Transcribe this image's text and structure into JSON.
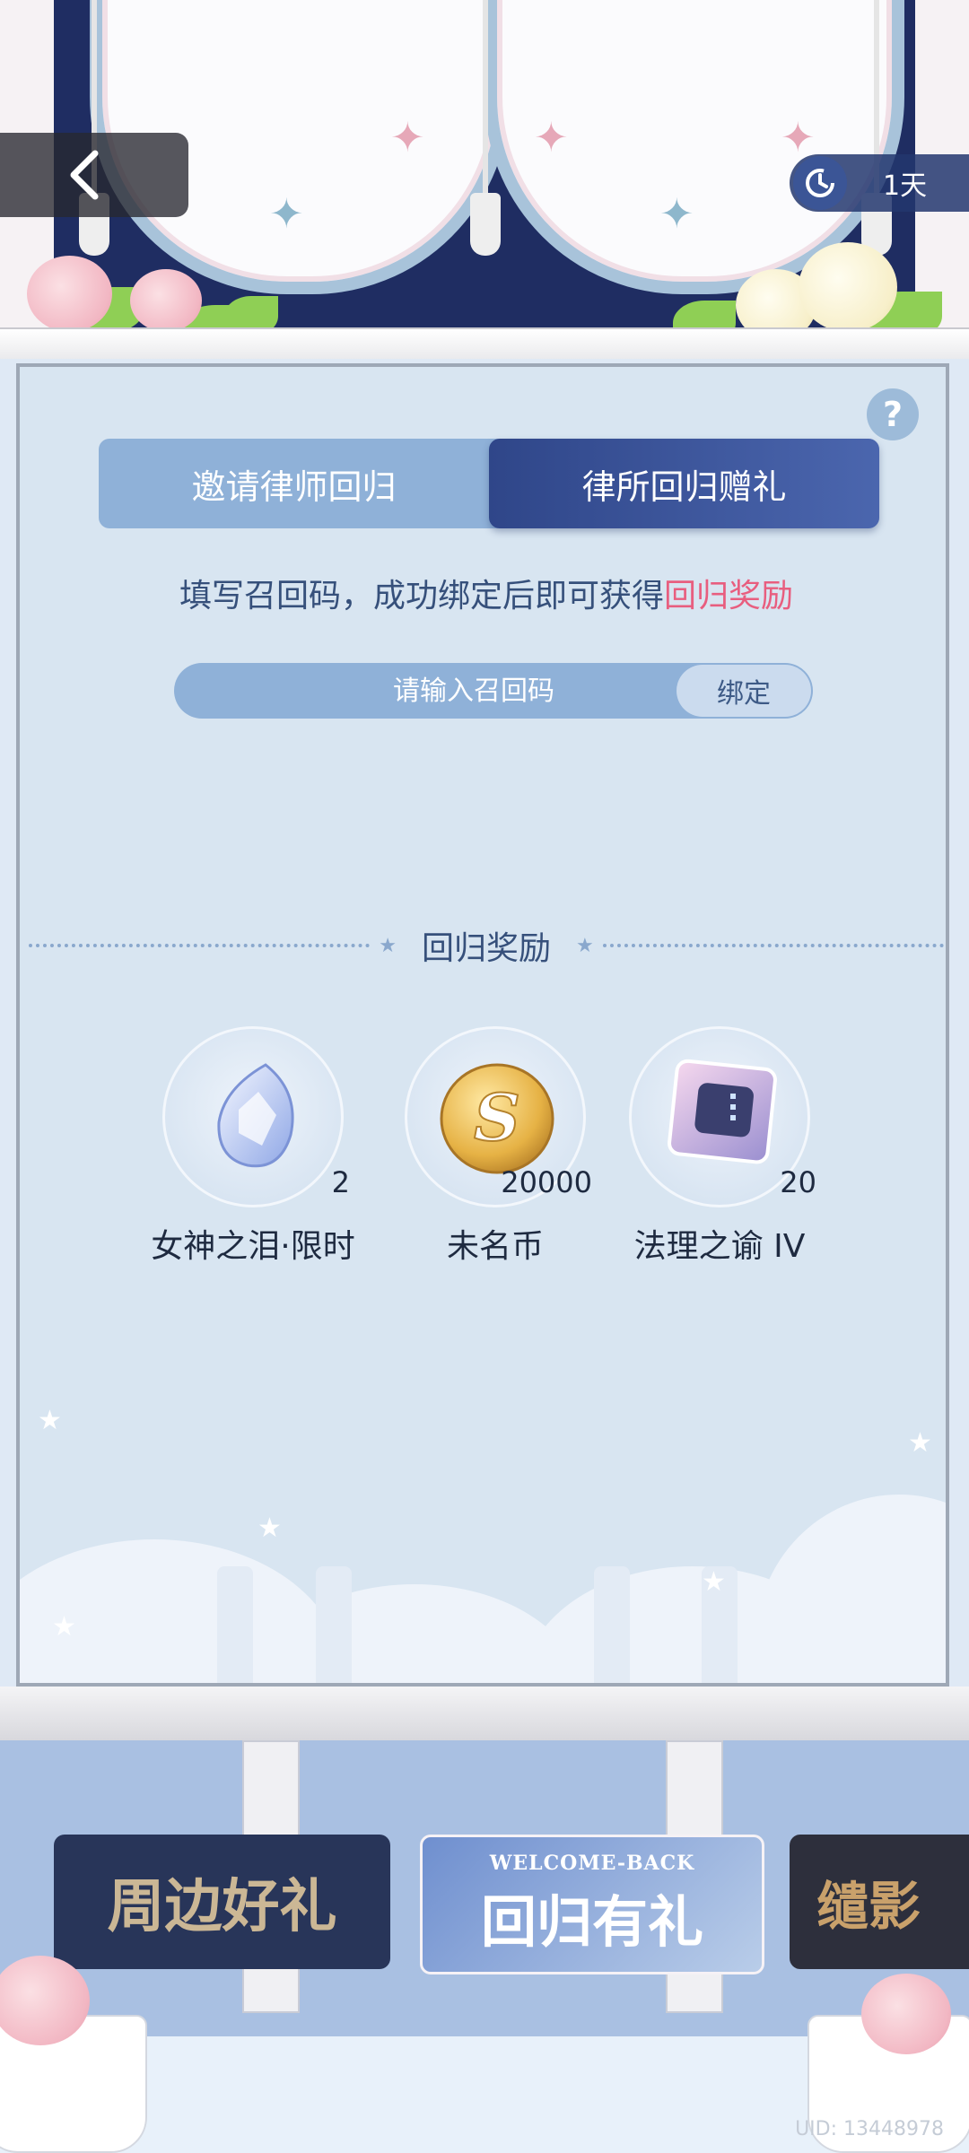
{
  "header": {
    "timer_text": "1天",
    "back_icon": "chevron-left-icon",
    "timer_icon": "clock-icon"
  },
  "tabs": [
    {
      "label": "邀请律师回归",
      "active": false
    },
    {
      "label": "律所回归赠礼",
      "active": true
    }
  ],
  "description": {
    "text": "填写召回码，成功绑定后即可获得",
    "highlight": "回归奖励"
  },
  "code_form": {
    "placeholder": "请输入召回码",
    "value": "",
    "bind_label": "绑定"
  },
  "rewards_section": {
    "title": "回归奖励",
    "items": [
      {
        "name": "女神之泪·限时",
        "count": "2",
        "icon": "crystal-tear-icon"
      },
      {
        "name": "未名币",
        "count": "20000",
        "icon": "gold-coin-icon"
      },
      {
        "name": "法理之谕 IV",
        "count": "20",
        "icon": "chip-card-icon"
      }
    ]
  },
  "banners": [
    {
      "label": "周边好礼"
    },
    {
      "sub": "WELCOME-BACK",
      "label": "回归有礼"
    },
    {
      "label": "缱影"
    }
  ],
  "footer": {
    "uid": "UID: 13448978"
  },
  "colors": {
    "navy": "#1f2d62",
    "panel_bg": "#d8e5f1",
    "tab_active": "#2f4689",
    "tab_inactive": "#8fb1d8",
    "highlight": "#e85e7f"
  }
}
